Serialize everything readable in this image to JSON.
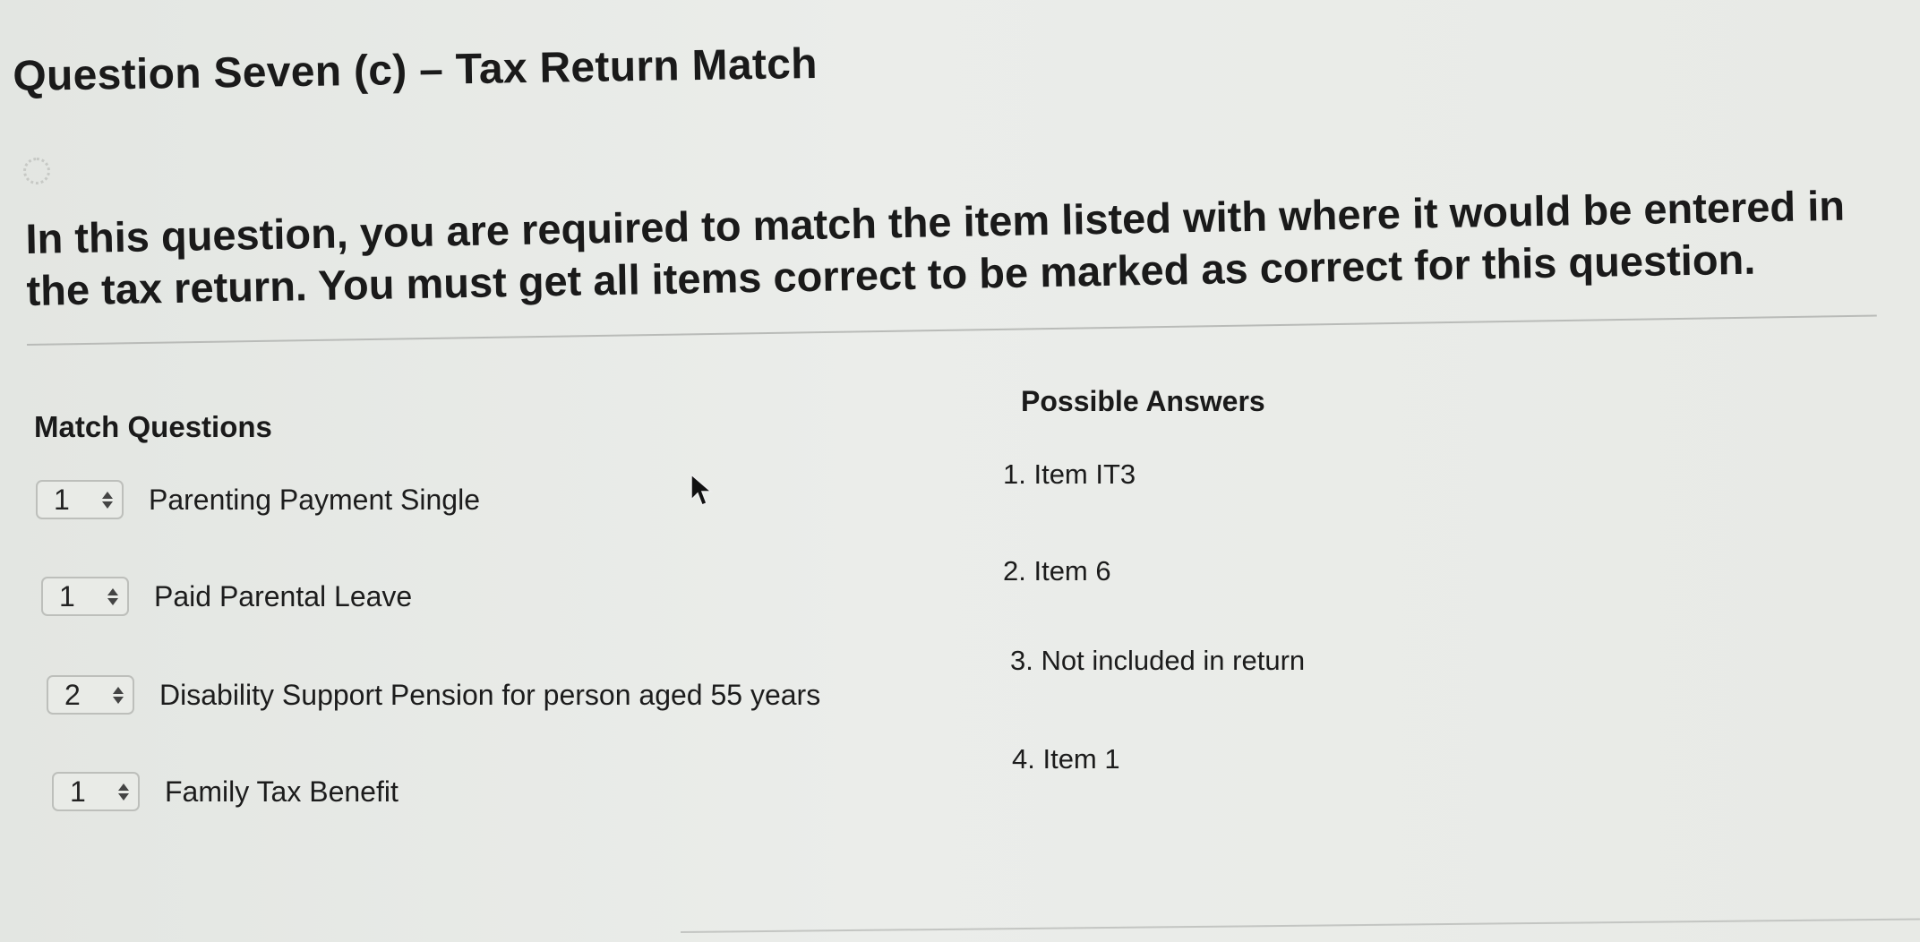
{
  "title": "Question Seven (c) – Tax Return Match",
  "instructions": "In this question, you are required to match the item listed with where it would be entered in the tax return. You must get all items correct to be marked as correct for this question.",
  "match_questions": {
    "heading": "Match Questions",
    "items": [
      {
        "selected": "1",
        "label": "Parenting Payment Single"
      },
      {
        "selected": "1",
        "label": "Paid Parental Leave"
      },
      {
        "selected": "2",
        "label": "Disability Support Pension for person aged 55 years"
      },
      {
        "selected": "1",
        "label": "Family Tax Benefit"
      }
    ]
  },
  "possible_answers": {
    "heading": "Possible Answers",
    "items": [
      "1. Item IT3",
      "2. Item 6",
      "3. Not included in return",
      "4. Item 1"
    ]
  },
  "icons": {
    "select_arrows": "up-down-chevron-icon",
    "cursor": "mouse-pointer-icon",
    "loading": "spinner-icon"
  }
}
